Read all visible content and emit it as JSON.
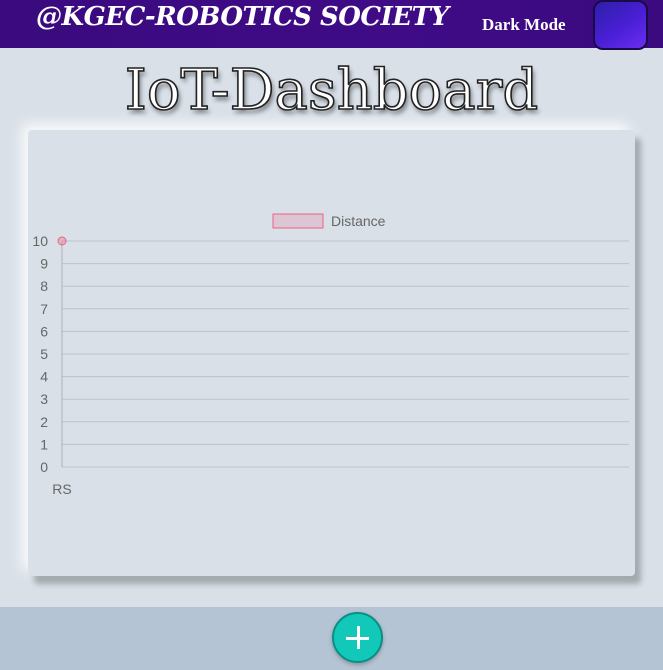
{
  "header": {
    "brand": "@KGEC-ROBOTICS SOCIETY",
    "mode_label": "Dark Mode"
  },
  "page": {
    "title": "IoT-Dashboard"
  },
  "chart_data": {
    "type": "line",
    "categories": [
      "RS"
    ],
    "series": [
      {
        "name": "Distance",
        "values": [
          10
        ],
        "color": "#f06080"
      }
    ],
    "ylim": [
      0,
      10
    ],
    "yticks": [
      "0",
      "1",
      "2",
      "3",
      "4",
      "5",
      "6",
      "7",
      "8",
      "9",
      "10"
    ],
    "grid": true,
    "legend_position": "top"
  },
  "footer": {
    "add_button_icon": "plus-icon"
  },
  "colors": {
    "header_bg": "#3f0b87",
    "toggle": "#4a1fd6",
    "fab": "#12c8b8",
    "series": "#f06080"
  }
}
